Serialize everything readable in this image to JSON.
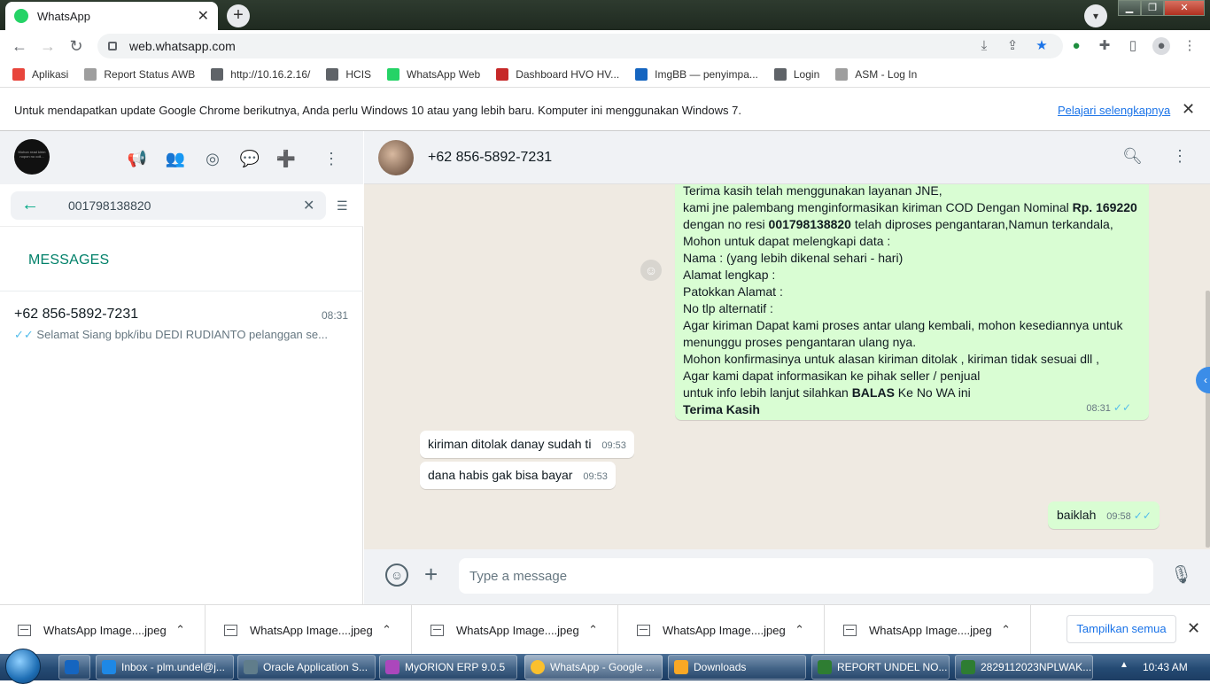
{
  "browser": {
    "tab_title": "WhatsApp",
    "url": "web.whatsapp.com",
    "bookmarks": [
      {
        "label": "Aplikasi",
        "color": "#e8453c"
      },
      {
        "label": "Report Status AWB",
        "color": "#9e9e9e"
      },
      {
        "label": "http://10.16.2.16/",
        "color": "#5f6368"
      },
      {
        "label": "HCIS",
        "color": "#5f6368"
      },
      {
        "label": "WhatsApp Web",
        "color": "#25d366"
      },
      {
        "label": "Dashboard HVO HV...",
        "color": "#c62828"
      },
      {
        "label": "ImgBB — penyimpa...",
        "color": "#1565c0"
      },
      {
        "label": "Login",
        "color": "#5f6368"
      },
      {
        "label": "ASM - Log In",
        "color": "#9e9e9e"
      }
    ],
    "infobar_text": "Untuk mendapatkan update Google Chrome berikutnya, Anda perlu Windows 10 atau yang lebih baru. Komputer ini menggunakan Windows 7.",
    "infobar_link": "Pelajari selengkapnya"
  },
  "sidebar": {
    "profile_text": "Mohon read kirim nopon no coli...",
    "search_value": "001798138820",
    "section_label": "MESSAGES",
    "result": {
      "name": "+62 856-5892-7231",
      "time": "08:31",
      "preview": "Selamat Siang   bpk/ibu DEDI RUDIANTO pelanggan se..."
    }
  },
  "chat": {
    "contact": "+62 856-5892-7231",
    "big_message": {
      "line1": "Terima kasih telah menggunakan layanan JNE,",
      "line2a": "kami jne palembang menginformasikan kiriman  COD Dengan Nominal ",
      "line2b": "Rp. 169220",
      "line2c": " dengan no resi ",
      "line2d": "001798138820",
      "line2e": " telah diproses pengantaran,Namun terkandala, Mohon untuk dapat melengkapi data :",
      "line3": "Nama : (yang lebih dikenal sehari - hari)",
      "line4": "Alamat  lengkap :",
      "line5": "Patokkan Alamat :",
      "line6": "No tlp alternatif :",
      "line7": "Agar kiriman Dapat kami proses antar ulang kembali, mohon kesediannya untuk menunggu proses pengantaran ulang nya.",
      "line8": "Mohon konfirmasinya untuk alasan kiriman ditolak , kiriman tidak sesuai dll ,",
      "line9": "Agar kami dapat informasikan ke pihak seller / penjual",
      "line10a": "untuk info lebih lanjut silahkan ",
      "line10b": "BALAS",
      "line10c": " Ke No WA ini",
      "line11": "Terima Kasih",
      "time": "08:31"
    },
    "messages": [
      {
        "text": "kiriman ditolak danay sudah ti",
        "time": "09:53",
        "dir": "in"
      },
      {
        "text": "dana habis gak bisa bayar",
        "time": "09:53",
        "dir": "in"
      },
      {
        "text": "baiklah",
        "time": "09:58",
        "dir": "out"
      }
    ],
    "composer_placeholder": "Type a message"
  },
  "downloads": {
    "items": [
      "WhatsApp Image....jpeg",
      "WhatsApp Image....jpeg",
      "WhatsApp Image....jpeg",
      "WhatsApp Image....jpeg",
      "WhatsApp Image....jpeg"
    ],
    "show_all": "Tampilkan semua"
  },
  "taskbar": {
    "items": [
      {
        "label": "Inbox - plm.undel@j...",
        "color": "#1e88e5"
      },
      {
        "label": "Oracle Application S...",
        "color": "#607d8b"
      },
      {
        "label": "MyORION ERP 9.0.5",
        "color": "#ab47bc"
      },
      {
        "label": "WhatsApp - Google ...",
        "color": "#fbc02d"
      },
      {
        "label": "Downloads",
        "color": "#f9a825"
      },
      {
        "label": "REPORT UNDEL NO...",
        "color": "#2e7d32"
      },
      {
        "label": "2829112023NPLWAK...",
        "color": "#2e7d32"
      }
    ],
    "clock": "10:43 AM"
  }
}
